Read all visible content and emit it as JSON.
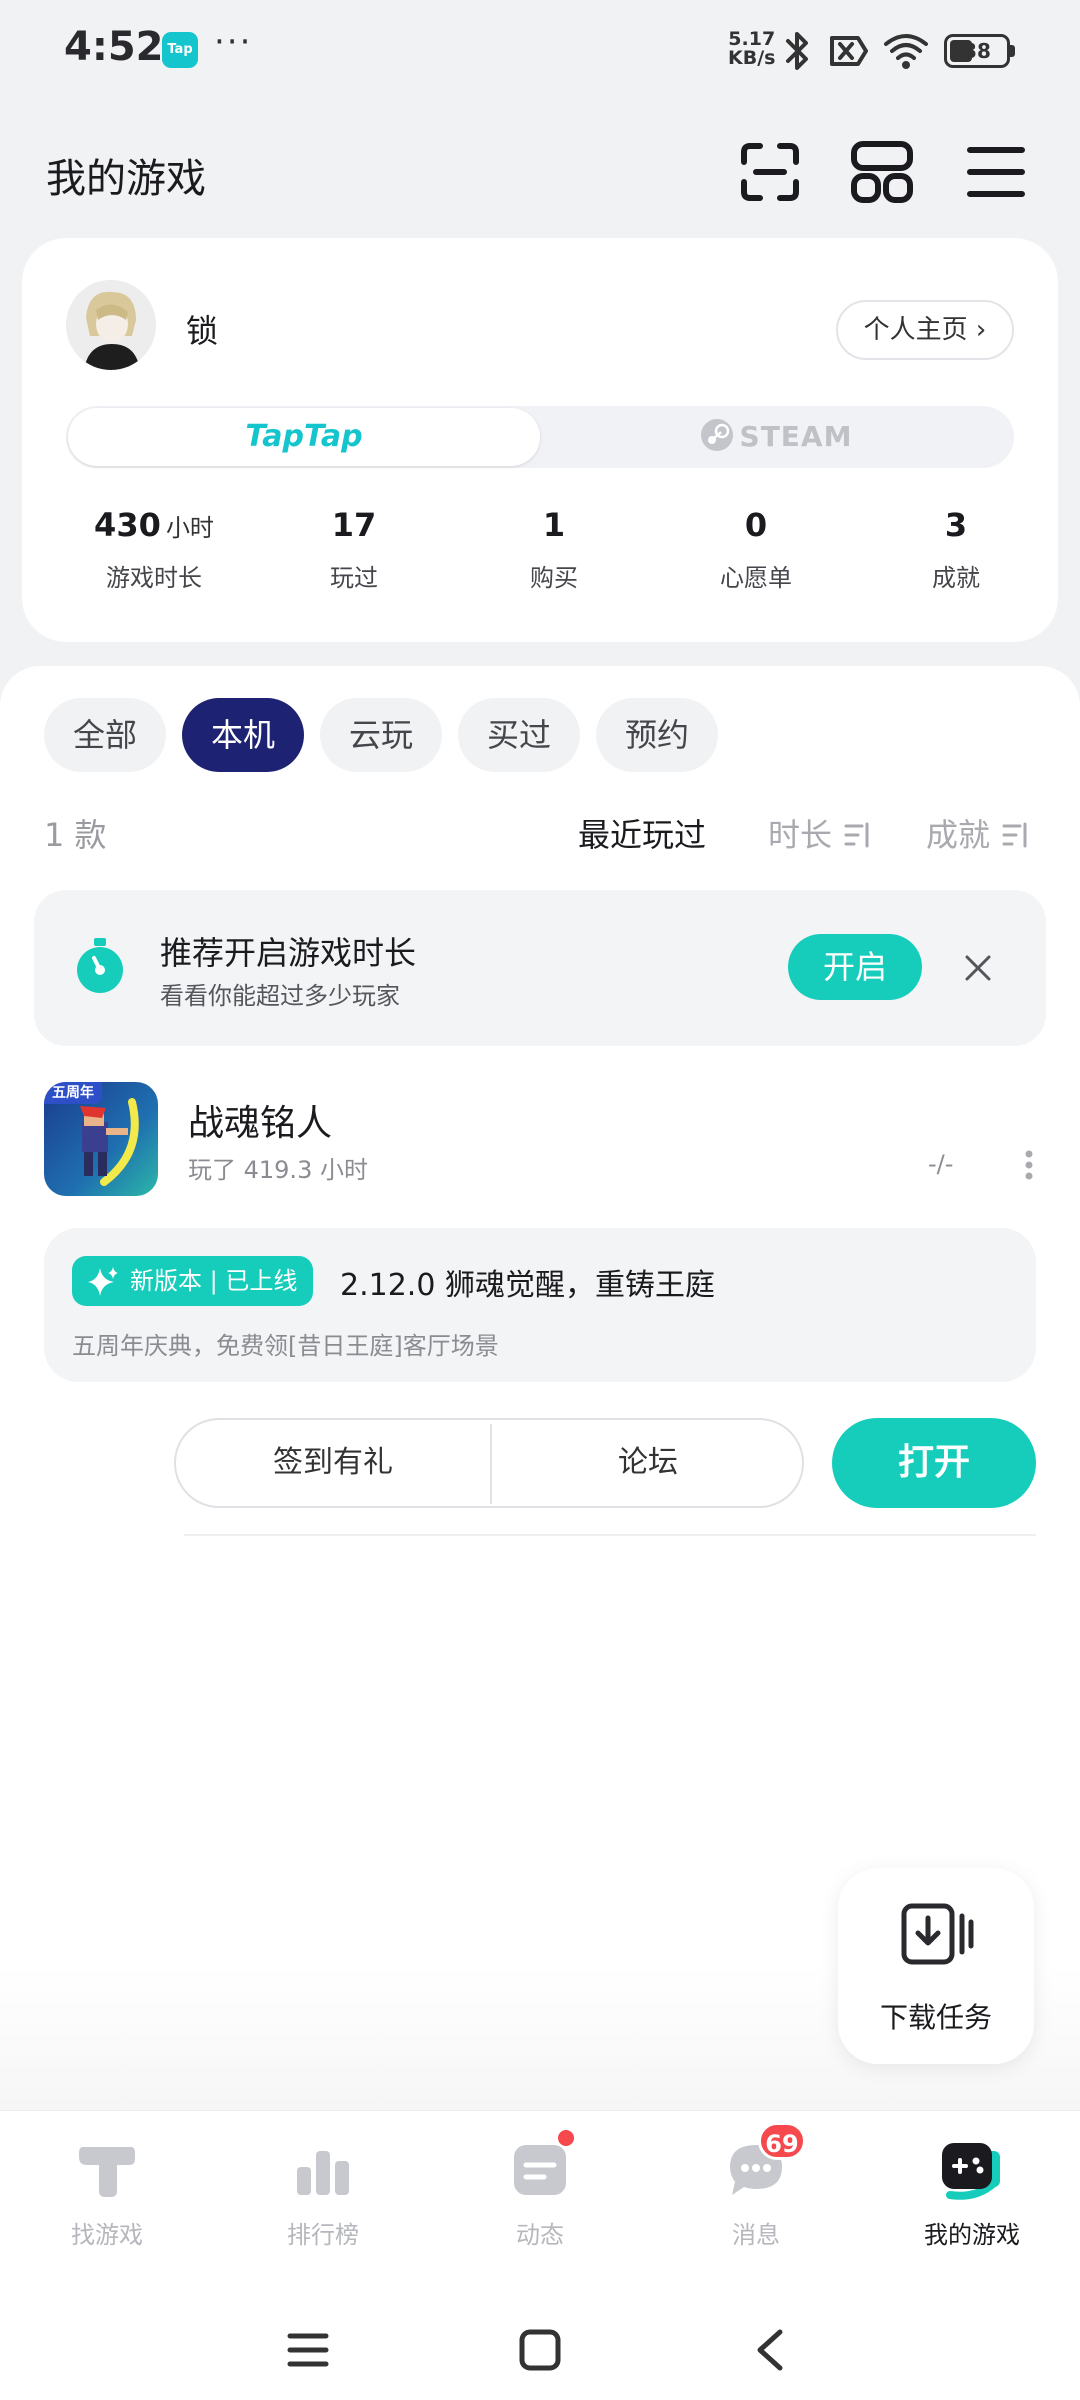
{
  "status_bar": {
    "time": "4:52",
    "app_badge": "Tap",
    "more": "···",
    "net_speed_value": "5.17",
    "net_speed_unit": "KB/s",
    "battery": "38"
  },
  "header": {
    "title": "我的游戏"
  },
  "profile": {
    "name": "锁",
    "home_button": "个人主页 ›",
    "platforms": [
      "TapTap",
      "STEAM"
    ],
    "stats": [
      {
        "value": "430",
        "unit": "小时",
        "label": "游戏时长"
      },
      {
        "value": "17",
        "unit": "",
        "label": "玩过"
      },
      {
        "value": "1",
        "unit": "",
        "label": "购买"
      },
      {
        "value": "0",
        "unit": "",
        "label": "心愿单"
      },
      {
        "value": "3",
        "unit": "",
        "label": "成就"
      }
    ]
  },
  "filters": {
    "chips": [
      "全部",
      "本机",
      "云玩",
      "买过",
      "预约"
    ],
    "active_index": 1,
    "count": "1 款",
    "sorts": [
      "最近玩过",
      "时长",
      "成就"
    ]
  },
  "tip": {
    "title": "推荐开启游戏时长",
    "subtitle": "看看你能超过多少玩家",
    "button": "开启"
  },
  "game": {
    "name": "战魂铭人",
    "played": "玩了 419.3 小时",
    "score": "-/-",
    "icon_badge": "五周年",
    "update_badge": "新版本 | 已上线",
    "update_title": "2.12.0 狮魂觉醒，重铸王庭",
    "update_subtitle": "五周年庆典，免费领[昔日王庭]客厅场景",
    "actions": [
      "签到有礼",
      "论坛"
    ],
    "open_button": "打开"
  },
  "download_task": {
    "label": "下载任务"
  },
  "bottom_nav": {
    "items": [
      "找游戏",
      "排行榜",
      "动态",
      "消息",
      "我的游戏"
    ],
    "active_index": 4,
    "message_badge": "69"
  },
  "colors": {
    "accent": "#15CDBA",
    "active_chip": "#1E2272",
    "badge": "#F5494D"
  }
}
